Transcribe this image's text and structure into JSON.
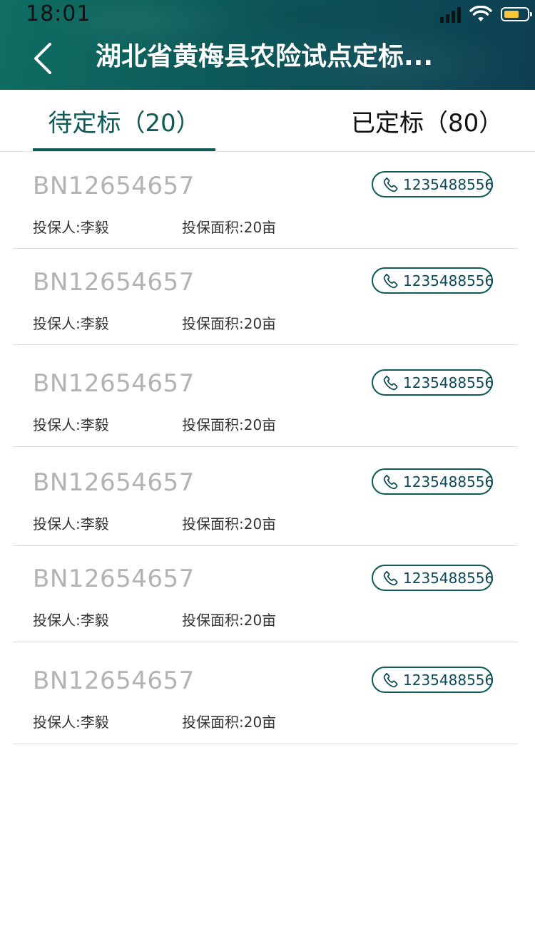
{
  "status_bar": {
    "time": "18:01",
    "battery_color": "#f6c636"
  },
  "header": {
    "title": "湖北省黄梅县农险试点定标...",
    "back_icon": "chevron-left-icon",
    "background_color": "#0f6e63"
  },
  "tabs": [
    {
      "label": "待定标（20）",
      "active": true
    },
    {
      "label": "已定标（80）",
      "active": false
    }
  ],
  "accent_color": "#0e5a57",
  "items": [
    {
      "bn": "BN12654657",
      "phone": "1235488556",
      "insured": "投保人:李毅",
      "area": "投保面积:20亩"
    },
    {
      "bn": "BN12654657",
      "phone": "1235488556",
      "insured": "投保人:李毅",
      "area": "投保面积:20亩"
    },
    {
      "bn": "BN12654657",
      "phone": "1235488556",
      "insured": "投保人:李毅",
      "area": "投保面积:20亩"
    },
    {
      "bn": "BN12654657",
      "phone": "1235488556",
      "insured": "投保人:李毅",
      "area": "投保面积:20亩"
    },
    {
      "bn": "BN12654657",
      "phone": "1235488556",
      "insured": "投保人:李毅",
      "area": "投保面积:20亩"
    },
    {
      "bn": "BN12654657",
      "phone": "1235488556",
      "insured": "投保人:李毅",
      "area": "投保面积:20亩"
    }
  ]
}
